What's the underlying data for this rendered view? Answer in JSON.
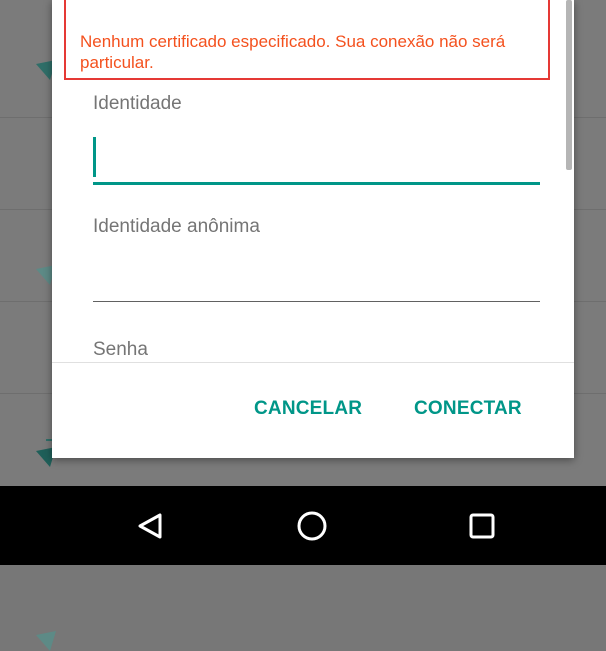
{
  "dialog": {
    "warning": "Nenhum certificado especificado. Sua conexão não será particular.",
    "identity_label": "Identidade",
    "identity_value": "",
    "anon_identity_label": "Identidade anônima",
    "anon_identity_value": "",
    "password_label": "Senha",
    "cancel_label": "CANCELAR",
    "connect_label": "CONECTAR"
  },
  "icons": {
    "back": "back-triangle-icon",
    "home": "home-circle-icon",
    "recents": "recents-square-icon"
  },
  "colors": {
    "accent": "#009688",
    "warning": "#f4511e",
    "warning_border": "#e53935",
    "navbar": "#000000"
  }
}
